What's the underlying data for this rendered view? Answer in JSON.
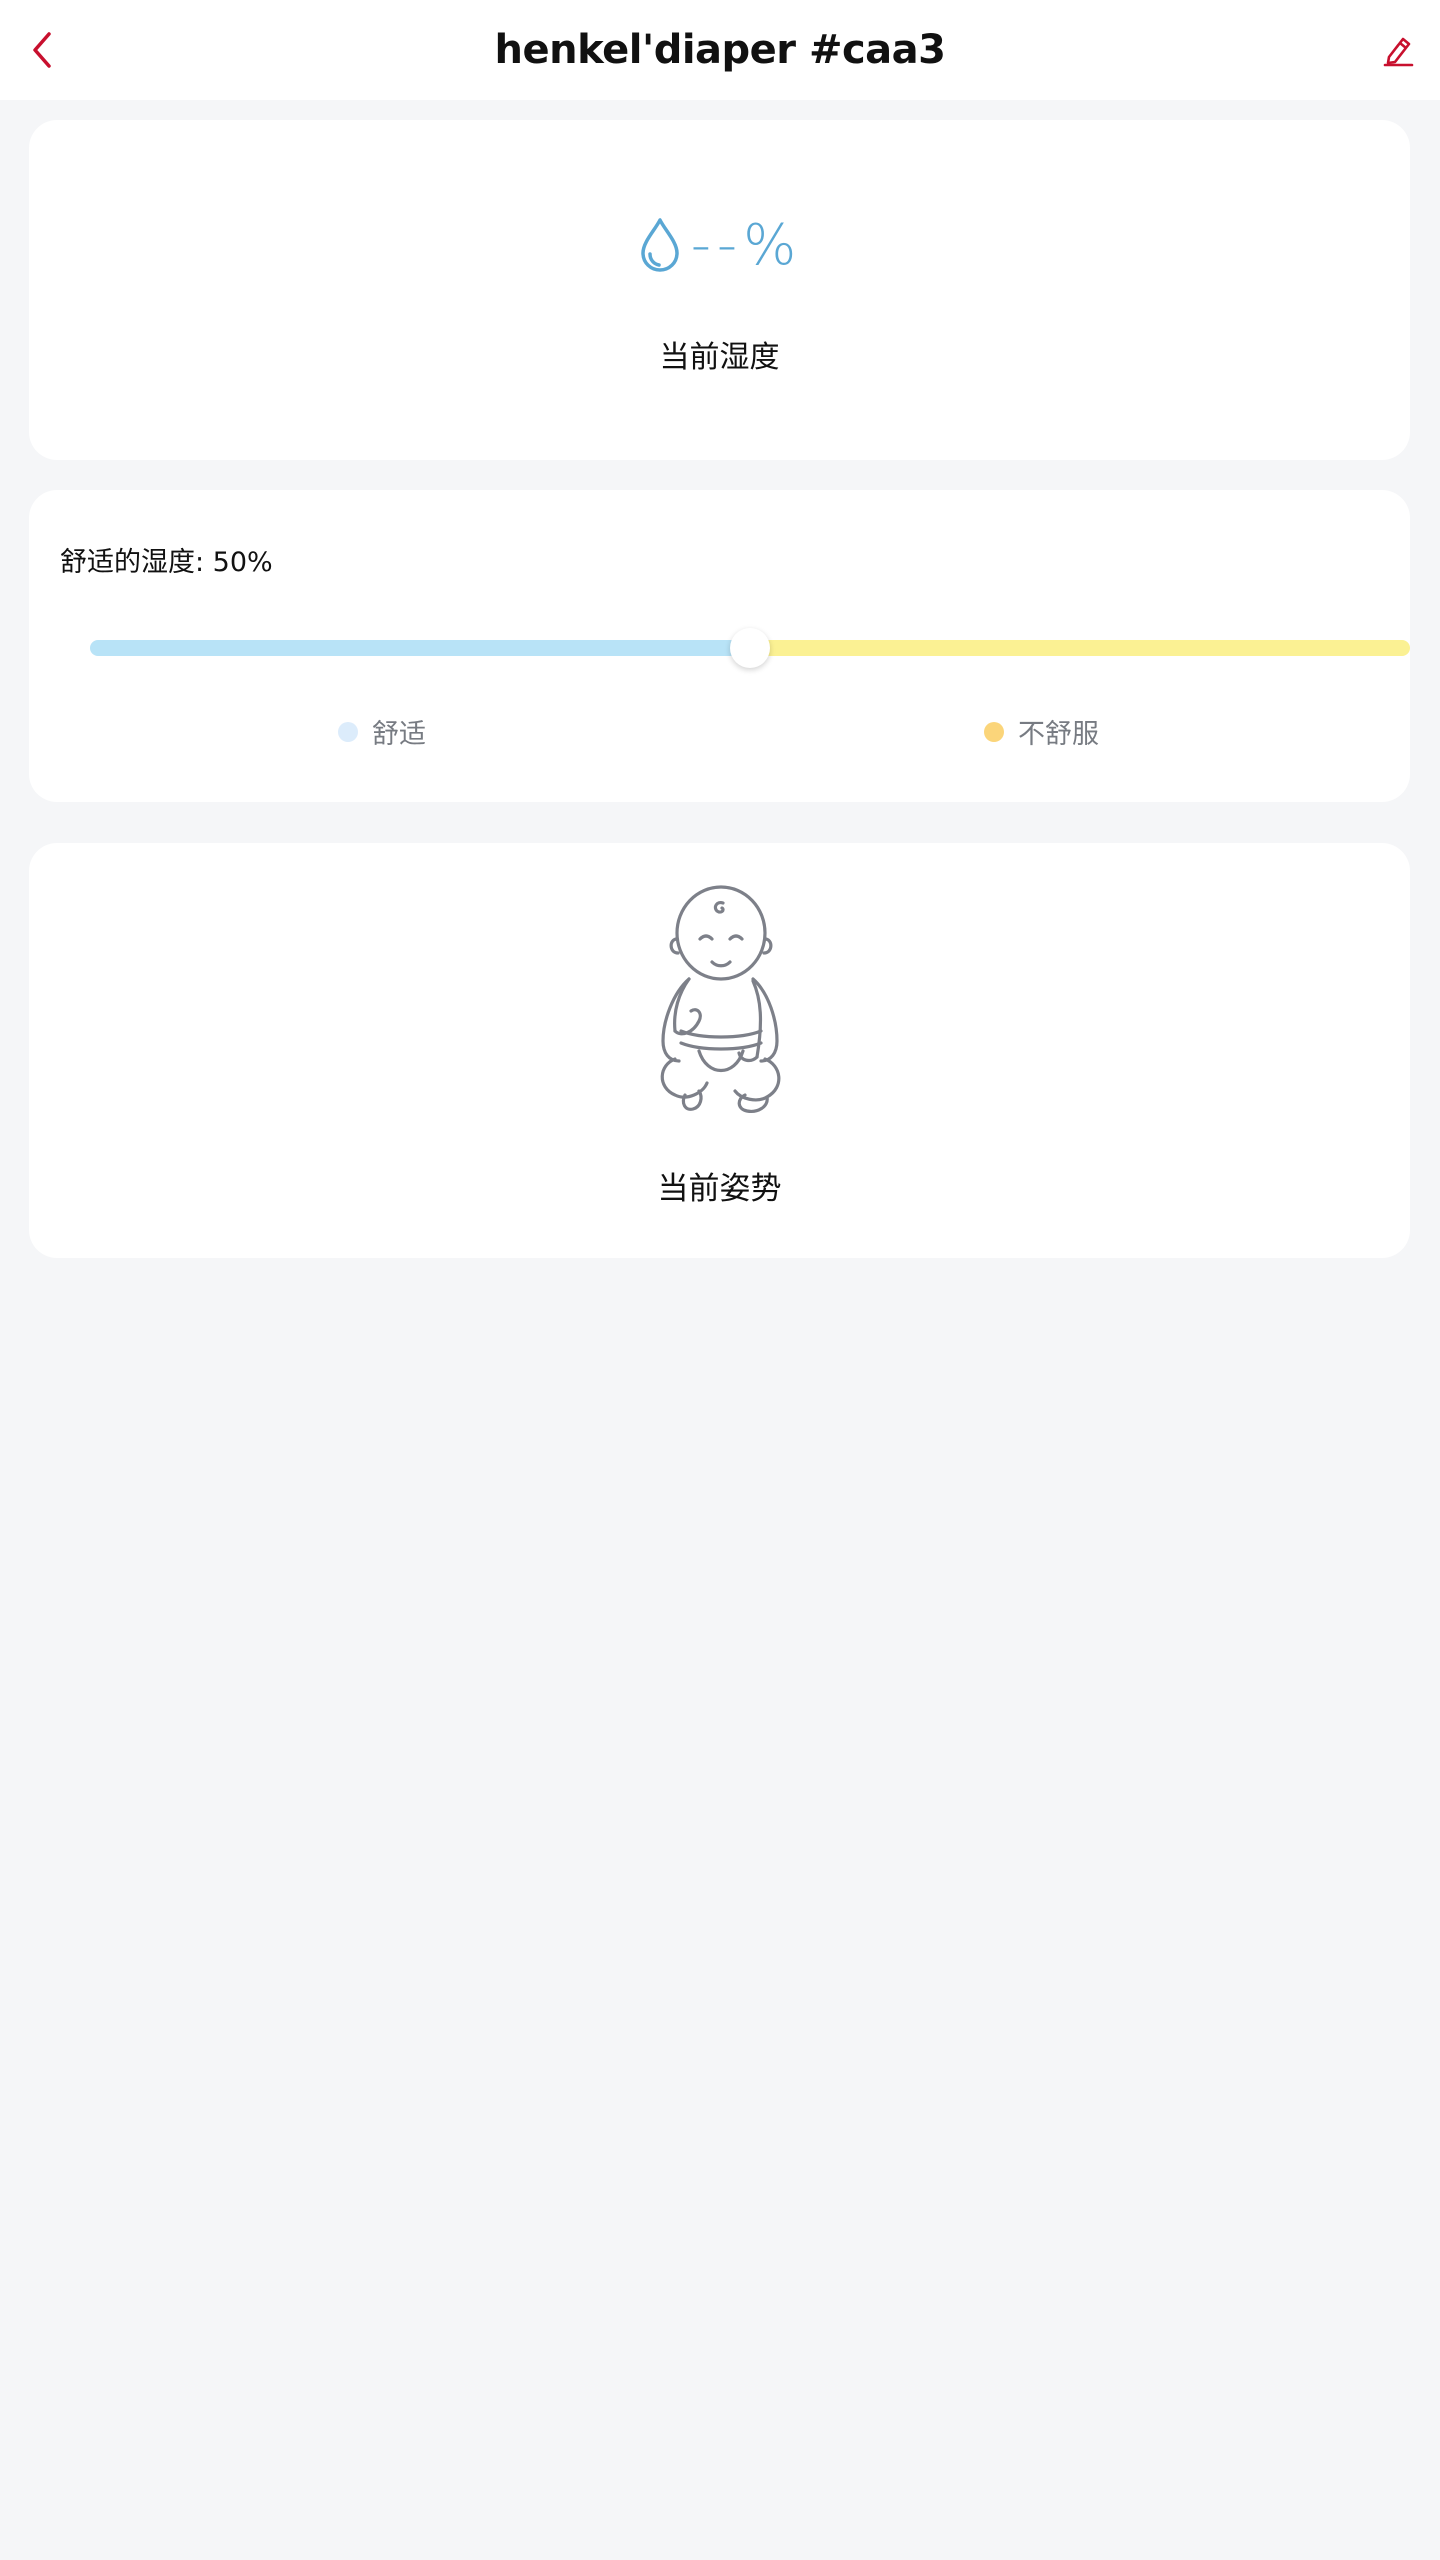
{
  "header": {
    "title": "henkel'diaper #caa3",
    "back_icon": "chevron-left-icon",
    "edit_icon": "pencil-icon"
  },
  "humidity": {
    "icon": "water-drop-icon",
    "value": "--%",
    "label": "当前湿度"
  },
  "comfort": {
    "title": "舒适的湿度: 50%",
    "threshold_percent": 50,
    "legend": [
      {
        "label": "舒适",
        "color": "#dcecfb"
      },
      {
        "label": "不舒服",
        "color": "#fbd57a"
      }
    ]
  },
  "posture": {
    "icon": "baby-sitting-icon",
    "label": "当前姿势"
  },
  "colors": {
    "accent": "#c8102e",
    "humidity_blue": "#5aa7d4",
    "track_comfort": "#b8e3f7",
    "track_uncomfort": "#fbf193",
    "background": "#f5f6f8"
  }
}
